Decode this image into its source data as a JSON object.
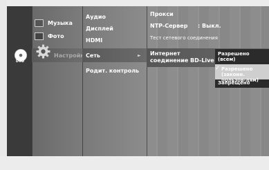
{
  "colors": {
    "popup_dark": "#2b2b2b",
    "popup_selected": "#cfcfcf"
  },
  "disc": {
    "label": "DVD",
    "icon": "disc-icon"
  },
  "main_menu": [
    {
      "label": "Музыка",
      "icon": "music-icon"
    },
    {
      "label": "Фото",
      "icon": "photo-icon"
    },
    {
      "label": "Настройки",
      "icon": "gear-icon"
    }
  ],
  "sub_menu": [
    {
      "label": "Аудио"
    },
    {
      "label": "Дисплей"
    },
    {
      "label": "HDMI"
    },
    {
      "label": "Сеть"
    },
    {
      "label": "Родит. контроль"
    }
  ],
  "details": {
    "proxy": "Прокси",
    "ntp_label": "NTP-Сервер",
    "ntp_value": ":  Выкл.",
    "test": "Тест сетевого соединения",
    "bdlive_line1": "Интернет",
    "bdlive_line2": "соединение BD-Live"
  },
  "popup": {
    "options": [
      {
        "line1": "Разрешено",
        "line2": "(всем)"
      },
      {
        "line1": "Разрешено (законн.",
        "line2": "пользов-лям)",
        "selected": true
      },
      {
        "line1": "Запрещено",
        "line2": ""
      }
    ]
  }
}
